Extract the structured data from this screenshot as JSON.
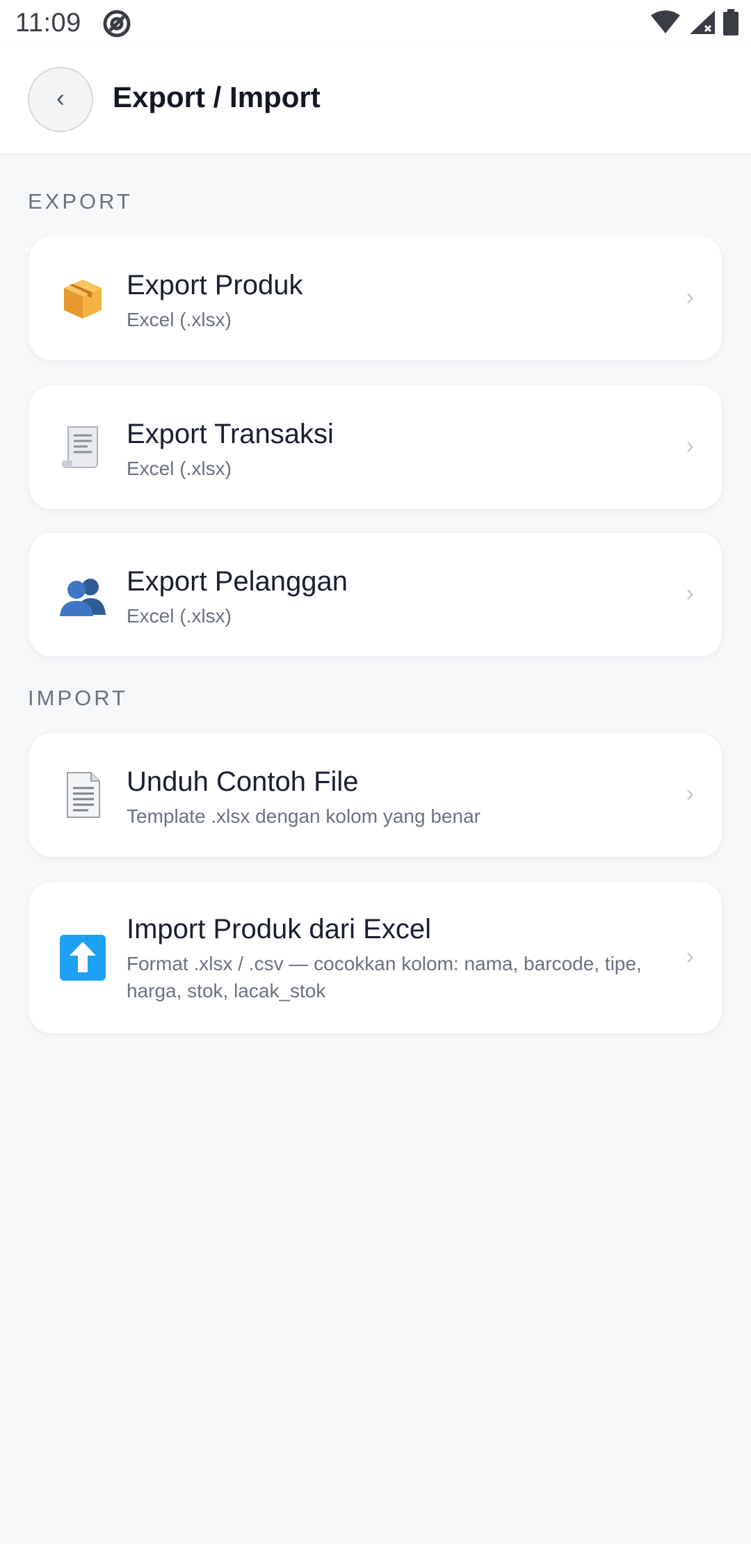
{
  "status_bar": {
    "time": "11:09"
  },
  "header": {
    "title": "Export / Import",
    "back_label": "‹"
  },
  "sections": {
    "export_label": "EXPORT",
    "import_label": "IMPORT"
  },
  "export_items": [
    {
      "title": "Export Produk",
      "subtitle": "Excel (.xlsx)",
      "icon": "package-icon"
    },
    {
      "title": "Export Transaksi",
      "subtitle": "Excel (.xlsx)",
      "icon": "receipt-icon"
    },
    {
      "title": "Export Pelanggan",
      "subtitle": "Excel (.xlsx)",
      "icon": "users-icon"
    }
  ],
  "import_items": [
    {
      "title": "Unduh Contoh File",
      "subtitle": "Template .xlsx dengan kolom yang benar",
      "icon": "document-icon"
    },
    {
      "title": "Import Produk dari Excel",
      "subtitle": "Format .xlsx / .csv — cocokkan kolom: nama, barcode, tipe, harga, stok, lacak_stok",
      "icon": "upload-arrow-icon"
    }
  ],
  "chevron": "›",
  "colors": {
    "background": "#f7f8fa",
    "card": "#ffffff",
    "title": "#1a1f2e",
    "subtitle": "#6b7280",
    "upload_icon": "#1da1f2"
  }
}
